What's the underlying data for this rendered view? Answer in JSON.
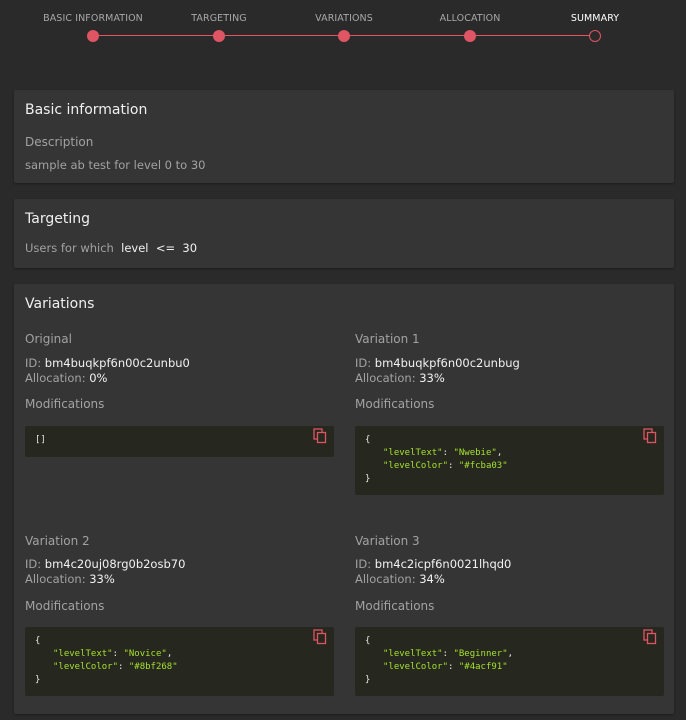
{
  "stepper": {
    "steps": [
      {
        "label": "BASIC INFORMATION",
        "state": "done"
      },
      {
        "label": "TARGETING",
        "state": "done"
      },
      {
        "label": "VARIATIONS",
        "state": "done"
      },
      {
        "label": "ALLOCATION",
        "state": "done"
      },
      {
        "label": "SUMMARY",
        "state": "current"
      }
    ],
    "accent_color": "#e05563"
  },
  "basic_info": {
    "title": "Basic information",
    "description_label": "Description",
    "description_value": "sample ab test for level 0 to 30"
  },
  "targeting": {
    "title": "Targeting",
    "prefix": "Users for which",
    "field": "level",
    "operator": "<=",
    "value": "30"
  },
  "variations": {
    "title": "Variations",
    "id_label": "ID:",
    "allocation_label": "Allocation:",
    "modifications_label": "Modifications",
    "items": [
      {
        "name": "Original",
        "id": "bm4buqkpf6n00c2unbu0",
        "allocation": "0%",
        "modifications": "[]",
        "mods": []
      },
      {
        "name": "Variation 1",
        "id": "bm4buqkpf6n00c2unbug",
        "allocation": "33%",
        "mods": [
          {
            "key": "\"levelText\"",
            "value": "\"Nwebie\""
          },
          {
            "key": "\"levelColor\"",
            "value": "\"#fcba03\""
          }
        ]
      },
      {
        "name": "Variation 2",
        "id": "bm4c20uj08rg0b2osb70",
        "allocation": "33%",
        "mods": [
          {
            "key": "\"levelText\"",
            "value": "\"Novice\""
          },
          {
            "key": "\"levelColor\"",
            "value": "\"#8bf268\""
          }
        ]
      },
      {
        "name": "Variation 3",
        "id": "bm4c2icpf6n0021lhqd0",
        "allocation": "34%",
        "mods": [
          {
            "key": "\"levelText\"",
            "value": "\"Beginner\""
          },
          {
            "key": "\"levelColor\"",
            "value": "\"#4acf91\""
          }
        ]
      }
    ]
  },
  "icons": {
    "copy": "copy-icon"
  }
}
